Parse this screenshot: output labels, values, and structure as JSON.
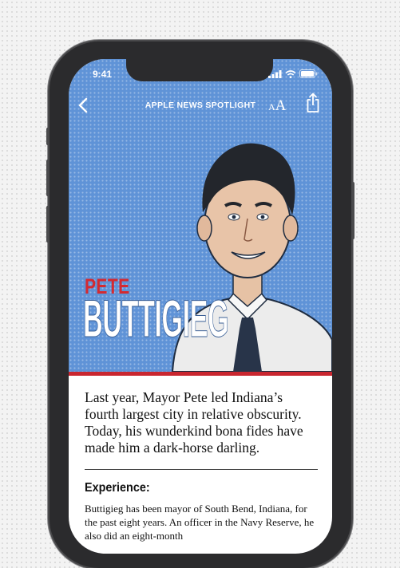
{
  "status_bar": {
    "time": "9:41"
  },
  "nav": {
    "back_icon": "chevron-left-icon",
    "title": "APPLE NEWS SPOTLIGHT",
    "text_size_small": "A",
    "text_size_large": "A",
    "share_icon": "share-icon"
  },
  "hero": {
    "first_name": "PETE",
    "last_name": "BUTTIGIEG",
    "background_color": "#5f93d7",
    "accent_color": "#c9262f"
  },
  "article": {
    "lede": "Last year, Mayor Pete led Indiana’s fourth largest city in relative obscurity. Today, his wunderkind bona fides have made him a dark-horse darling.",
    "section_heading": "Experience:",
    "body": "Buttigieg has been mayor of South Bend, Indiana, for the past eight years. An officer in the Navy Reserve, he also did an eight-month"
  }
}
